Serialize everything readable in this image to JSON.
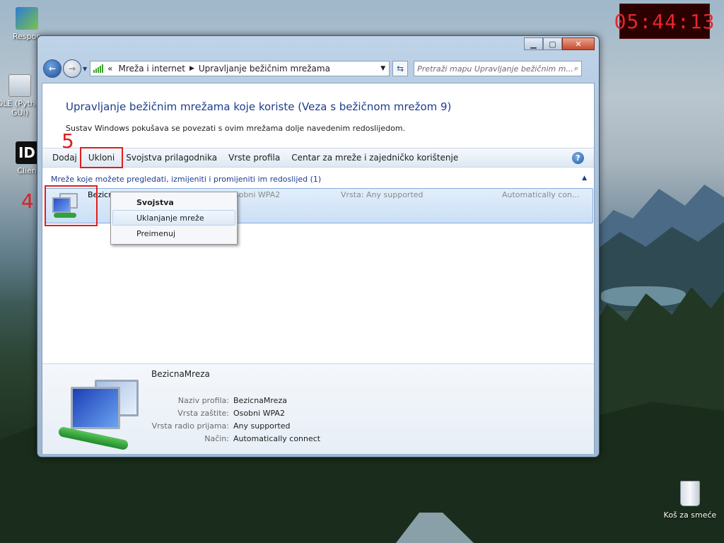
{
  "desktop": {
    "icons": [
      {
        "label": "Respon"
      },
      {
        "label": "IDLE (Python GUI)"
      },
      {
        "label": "Clien"
      }
    ],
    "recycle_bin": "Koš za smeće",
    "clock": "05:44:13"
  },
  "window": {
    "address": {
      "prefix": "«",
      "crumbs": [
        "Mreža i internet",
        "Upravljanje bežičnim mrežama"
      ]
    },
    "search_placeholder": "Pretraži mapu Upravljanje bežičnim m...",
    "title": "Upravljanje bežičnim mrežama koje koriste (Veza s bežičnom mrežom 9)",
    "description": "Sustav Windows pokušava se povezati s ovim mrežama dolje navedenim redoslijedom.",
    "toolbar": [
      "Dodaj",
      "Ukloni",
      "Svojstva prilagodnika",
      "Vrste profila",
      "Centar za mreže i zajedničko korištenje"
    ],
    "group_header": "Mreže koje možete pregledati, izmijeniti i promijeniti im redoslijed (1)",
    "network": {
      "name": "BezicnaMreza",
      "security": "Sigurnost: Osobni WPA2",
      "type": "Vrsta:  Any supported",
      "mode": "Automatically con..."
    },
    "context_menu": [
      "Svojstva",
      "Uklanjanje mreže",
      "Preimenuj"
    ],
    "details": {
      "name": "BezicnaMreza",
      "rows": [
        {
          "k": "Naziv profila:",
          "v": "BezicnaMreza"
        },
        {
          "k": "Vrsta zaštite:",
          "v": "Osobni WPA2"
        },
        {
          "k": "Vrsta radio prijama:",
          "v": "Any supported"
        },
        {
          "k": "Način:",
          "v": "Automatically connect"
        }
      ]
    }
  },
  "annotations": {
    "step4": "4",
    "step5": "5"
  }
}
